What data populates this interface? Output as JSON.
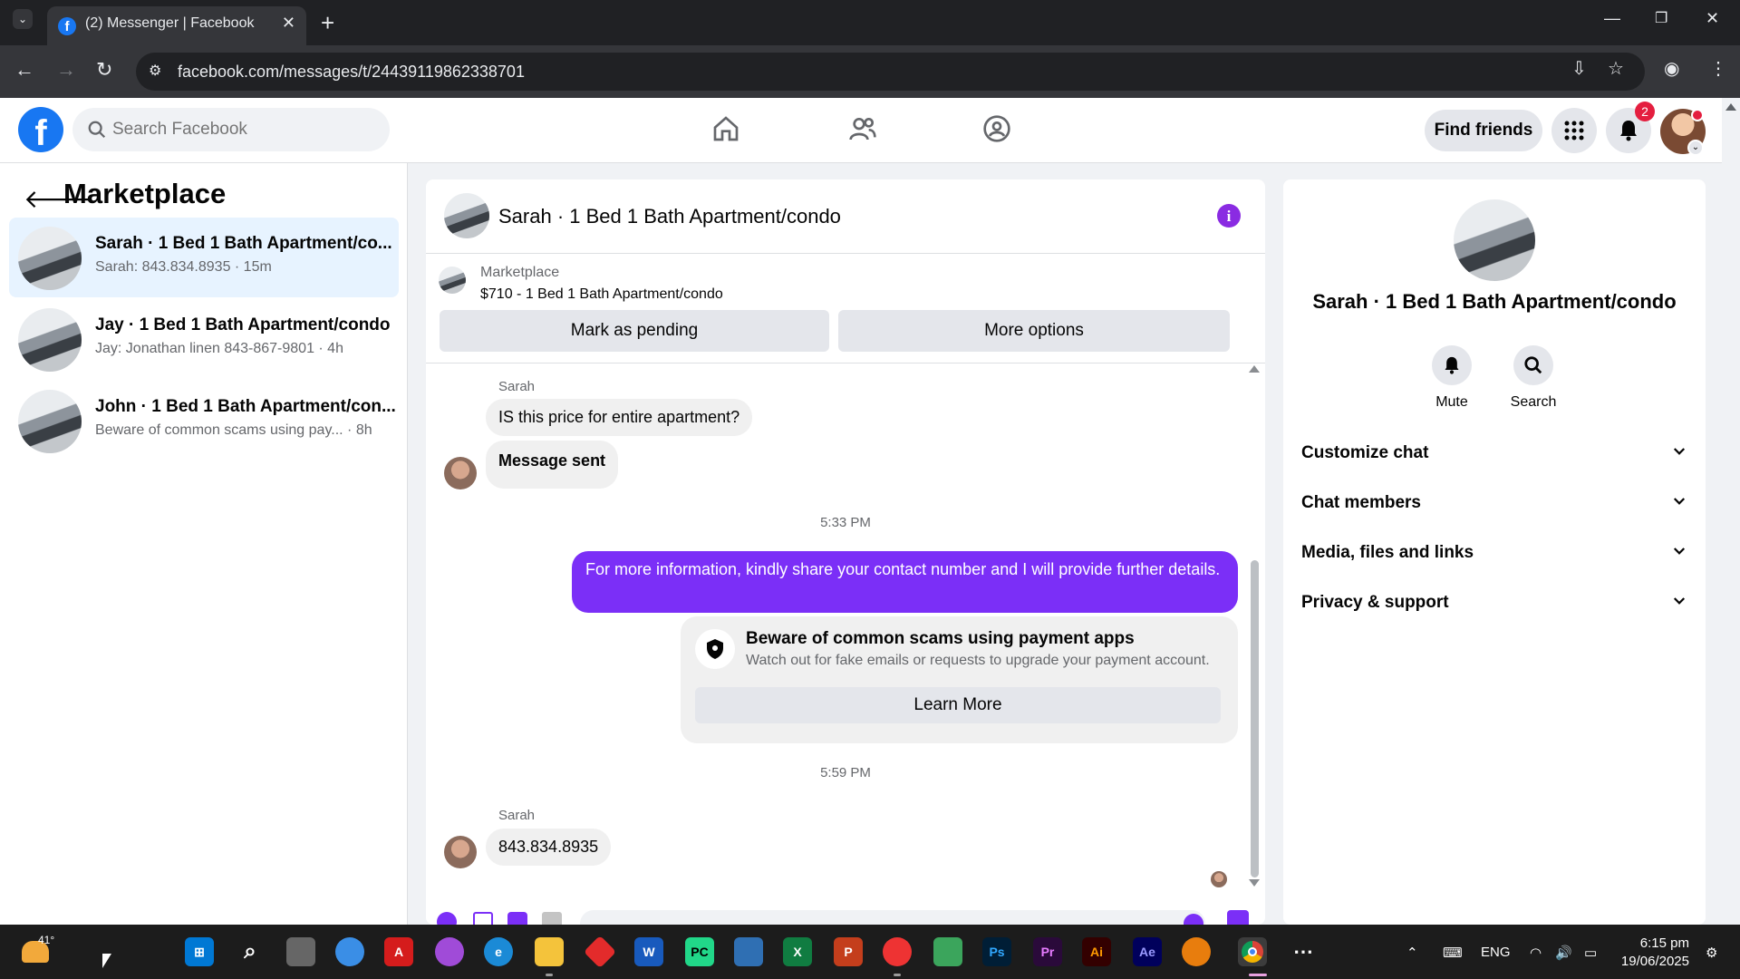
{
  "browser": {
    "tab_title": "(2) Messenger | Facebook",
    "url": "facebook.com/messages/t/24439119862338701"
  },
  "fb_header": {
    "search_placeholder": "Search Facebook",
    "find_friends_label": "Find friends",
    "notification_count": "2"
  },
  "left_panel": {
    "title": "Marketplace",
    "conversations": [
      {
        "title": "Sarah · 1 Bed 1 Bath Apartment/co...",
        "subtitle": "Sarah: 843.834.8935 · 15m",
        "active": true
      },
      {
        "title": "Jay · 1 Bed 1 Bath Apartment/condo",
        "subtitle": "Jay: Jonathan linen 843-867-9801 · 4h",
        "active": false
      },
      {
        "title": "John · 1 Bed 1 Bath Apartment/con...",
        "subtitle": "Beware of common scams using pay...   · 8h",
        "active": false
      }
    ]
  },
  "chat": {
    "header_title": "Sarah · 1 Bed 1 Bath Apartment/condo",
    "marketplace_label": "Marketplace",
    "listing": "$710 - 1 Bed 1 Bath Apartment/condo",
    "mark_pending_label": "Mark as pending",
    "more_options_label": "More options",
    "messages": {
      "sender_1": "Sarah",
      "msg_1": "IS this price for entire apartment?",
      "msg_2": "Message sent",
      "time_1": "5:33 PM",
      "outgoing": "For more information, kindly share your contact number and I will provide further details.",
      "scam_title": "Beware of common scams using payment apps",
      "scam_sub": "Watch out for fake emails or requests to upgrade your payment account.",
      "learn_more": "Learn More",
      "time_2": "5:59 PM",
      "sender_2": "Sarah",
      "msg_3": "843.834.8935"
    }
  },
  "right_panel": {
    "title": "Sarah · 1 Bed 1 Bath Apartment/condo",
    "mute_label": "Mute",
    "search_label": "Search",
    "rows": [
      "Customize chat",
      "Chat members",
      "Media, files and links",
      "Privacy & support"
    ]
  },
  "taskbar": {
    "weather": "41°",
    "language": "ENG",
    "time": "6:15 pm",
    "date": "19/06/2025"
  },
  "colors": {
    "fb_blue": "#1877f2",
    "outgoing_bubble": "#7b2ff7",
    "badge_red": "#e41e3f",
    "active_conversation": "#e7f3ff"
  }
}
